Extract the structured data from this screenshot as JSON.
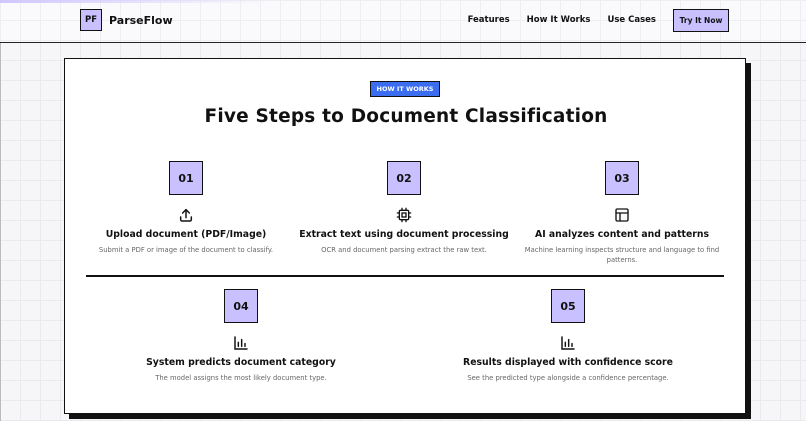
{
  "nav": {
    "logo": "PF",
    "brand": "ParseFlow",
    "links": [
      "Features",
      "How It Works",
      "Use Cases"
    ],
    "cta": "Try It Now"
  },
  "section": {
    "badge": "HOW IT WORKS",
    "title": "Five Steps to Document Classification"
  },
  "steps": [
    {
      "num": "01",
      "icon": "upload-icon",
      "title": "Upload document (PDF/Image)",
      "desc": "Submit a PDF or image of the document to classify."
    },
    {
      "num": "02",
      "icon": "chip-icon",
      "title": "Extract text using document processing",
      "desc": "OCR and document parsing extract the raw text."
    },
    {
      "num": "03",
      "icon": "layout-icon",
      "title": "AI analyzes content and patterns",
      "desc": "Machine learning inspects structure and language to find patterns."
    },
    {
      "num": "04",
      "icon": "bar-chart-icon",
      "title": "System predicts document category",
      "desc": "The model assigns the most likely document type."
    },
    {
      "num": "05",
      "icon": "bar-chart-icon",
      "title": "Results displayed with confidence score",
      "desc": "See the predicted type alongside a confidence percentage."
    }
  ]
}
